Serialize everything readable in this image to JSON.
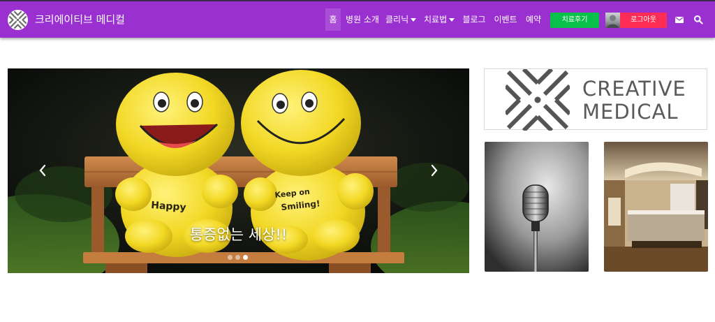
{
  "navbar": {
    "brand_title": "크리에이티브 메디컬",
    "items": [
      {
        "label": "홈",
        "active": true
      },
      {
        "label": "병원 소개"
      },
      {
        "label": "클리닉",
        "dropdown": true
      },
      {
        "label": "치료법",
        "dropdown": true
      },
      {
        "label": "블로그"
      },
      {
        "label": "이벤트"
      },
      {
        "label": "예약"
      }
    ],
    "review_button": "치료후기",
    "logout_button": "로그아웃",
    "icons": [
      "envelope-icon",
      "search-icon"
    ]
  },
  "slider": {
    "caption": "통증없는 세상!!",
    "plush_left_text": "Happy",
    "plush_right_text_1": "Keep on",
    "plush_right_text_2": "Smiling!",
    "slide_count": 3,
    "active_slide": 3
  },
  "brand_card": {
    "line1": "CREATIVE",
    "line2": "MEDICAL"
  },
  "colors": {
    "navbar": "#9b30d0",
    "review_button": "#08c04a",
    "logout_button": "#ff2d55"
  }
}
